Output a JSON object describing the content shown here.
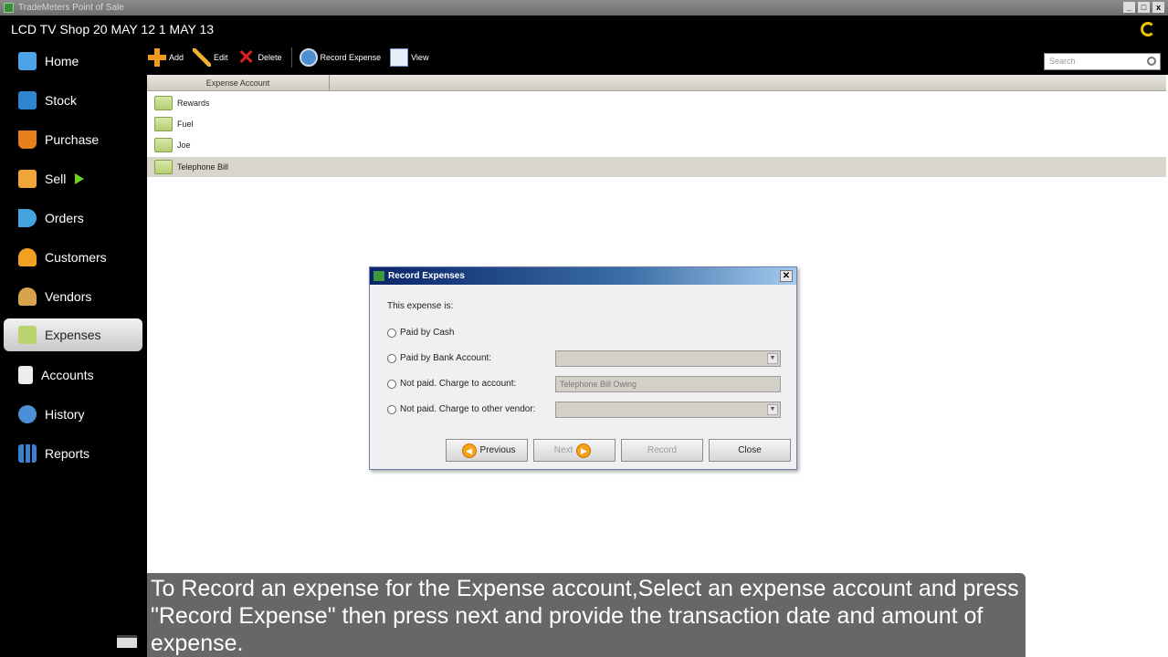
{
  "window": {
    "title": "TradeMeters Point of Sale",
    "controls": [
      "_",
      "□",
      "x"
    ]
  },
  "header": {
    "shop_title": "LCD TV Shop 20 MAY 12 1 MAY 13"
  },
  "sidebar": {
    "items": [
      {
        "label": "Home",
        "icon": "home-icon",
        "color": "#4da3e8"
      },
      {
        "label": "Stock",
        "icon": "stock-icon",
        "color": "#2e86d1"
      },
      {
        "label": "Purchase",
        "icon": "basket-icon",
        "color": "#e77f1c"
      },
      {
        "label": "Sell",
        "icon": "sell-icon",
        "color": "#f0a43a"
      },
      {
        "label": "Orders",
        "icon": "orders-icon",
        "color": "#45a3e0"
      },
      {
        "label": "Customers",
        "icon": "customer-icon",
        "color": "#f2a024"
      },
      {
        "label": "Vendors",
        "icon": "vendor-icon",
        "color": "#d7a24b"
      },
      {
        "label": "Expenses",
        "icon": "expenses-icon",
        "color": "#b9d36f"
      },
      {
        "label": "Accounts",
        "icon": "accounts-icon",
        "color": "#eeeeee"
      },
      {
        "label": "History",
        "icon": "history-icon",
        "color": "#4d8fd6"
      },
      {
        "label": "Reports",
        "icon": "reports-icon",
        "color": "#3b7fd0"
      }
    ],
    "active": "Expenses"
  },
  "toolbar": {
    "add": "Add",
    "edit": "Edit",
    "delete": "Delete",
    "record_expense": "Record Expense",
    "view": "View",
    "search_placeholder": "Search"
  },
  "grid": {
    "column": "Expense Account",
    "rows": [
      "Rewards",
      "Fuel",
      "Joe",
      "Telephone Bill"
    ],
    "selected_row": "Telephone Bill"
  },
  "dialog": {
    "title": "Record Expenses",
    "prompt": "This expense is:",
    "options": [
      "Paid by Cash",
      "Paid by Bank Account:",
      "Not paid. Charge to account:",
      "Not paid. Charge to other vendor:"
    ],
    "charge_account_value": "Telephone Bill Owing",
    "buttons": {
      "previous": "Previous",
      "next": "Next",
      "record": "Record",
      "close": "Close"
    }
  },
  "caption": "To Record an expense for the Expense account,Select an expense account and press \"Record Expense\" then press next and provide the transaction date and amount of expense."
}
